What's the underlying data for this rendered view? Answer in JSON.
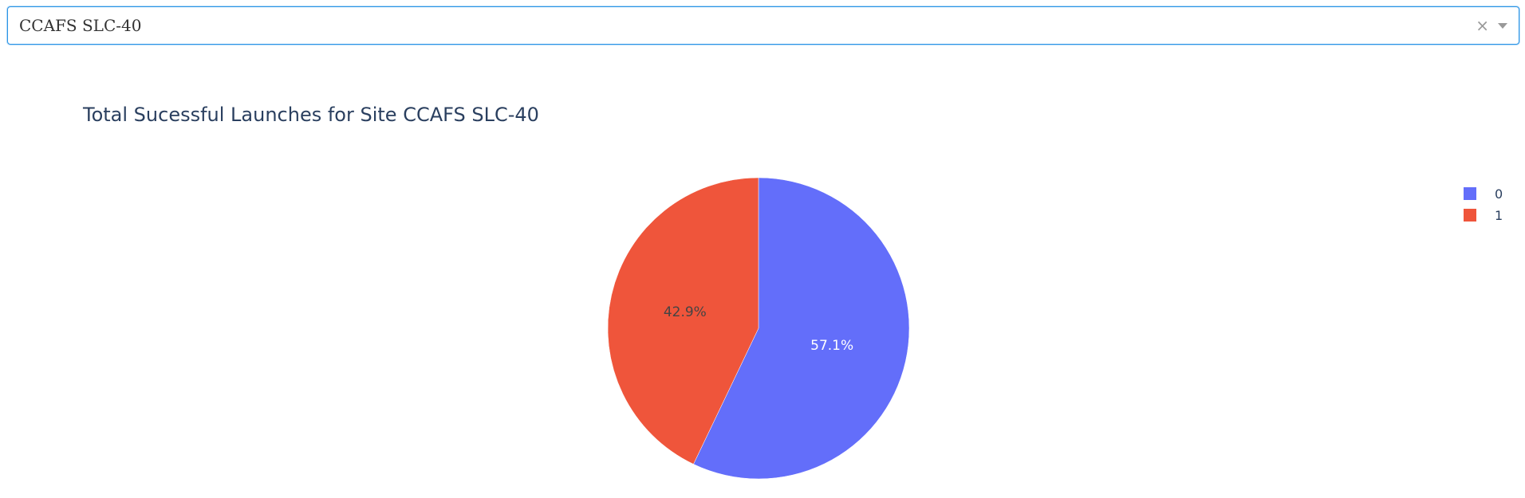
{
  "dropdown": {
    "selected": "CCAFS SLC-40",
    "clear_symbol": "×"
  },
  "chart_data": {
    "type": "pie",
    "title": "Total Sucessful Launches for Site CCAFS SLC-40",
    "categories": [
      "0",
      "1"
    ],
    "values": [
      57.1,
      42.9
    ],
    "labels": [
      "57.1%",
      "42.9%"
    ],
    "colors": [
      "#636efa",
      "#ef553b"
    ],
    "label_colors": [
      "#ffffff",
      "#444444"
    ],
    "legend": "top-right"
  }
}
